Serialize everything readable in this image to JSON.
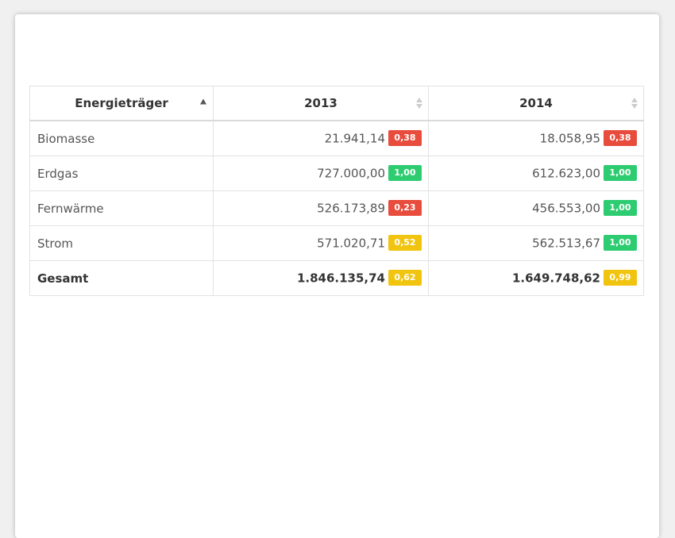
{
  "table": {
    "columns": [
      {
        "label": "Energieträger",
        "sort": "asc"
      },
      {
        "label": "2013",
        "sort": "none"
      },
      {
        "label": "2014",
        "sort": "none"
      }
    ],
    "rows": [
      {
        "name": "Biomasse",
        "v2013": "21.941,14",
        "b2013": "0,38",
        "v2014": "18.058,95",
        "b2014": "0,38"
      },
      {
        "name": "Erdgas",
        "v2013": "727.000,00",
        "b2013": "1,00",
        "v2014": "612.623,00",
        "b2014": "1,00"
      },
      {
        "name": "Fernwärme",
        "v2013": "526.173,89",
        "b2013": "0,23",
        "v2014": "456.553,00",
        "b2014": "1,00"
      },
      {
        "name": "Strom",
        "v2013": "571.020,71",
        "b2013": "0,52",
        "v2014": "562.513,67",
        "b2014": "1,00"
      }
    ],
    "total": {
      "name": "Gesamt",
      "v2013": "1.846.135,74",
      "b2013": "0,62",
      "v2014": "1.649.748,62",
      "b2014": "0,99"
    }
  },
  "colors": {
    "badge_red": "#e74c3c",
    "badge_green": "#2ecc71",
    "badge_yellow": "#f1c40f",
    "sort_active": "#555555",
    "sort_inactive": "#cccccc"
  },
  "icons": {
    "sort_ascending": "sort-ascending-icon",
    "sort_both": "sort-both-icon"
  }
}
